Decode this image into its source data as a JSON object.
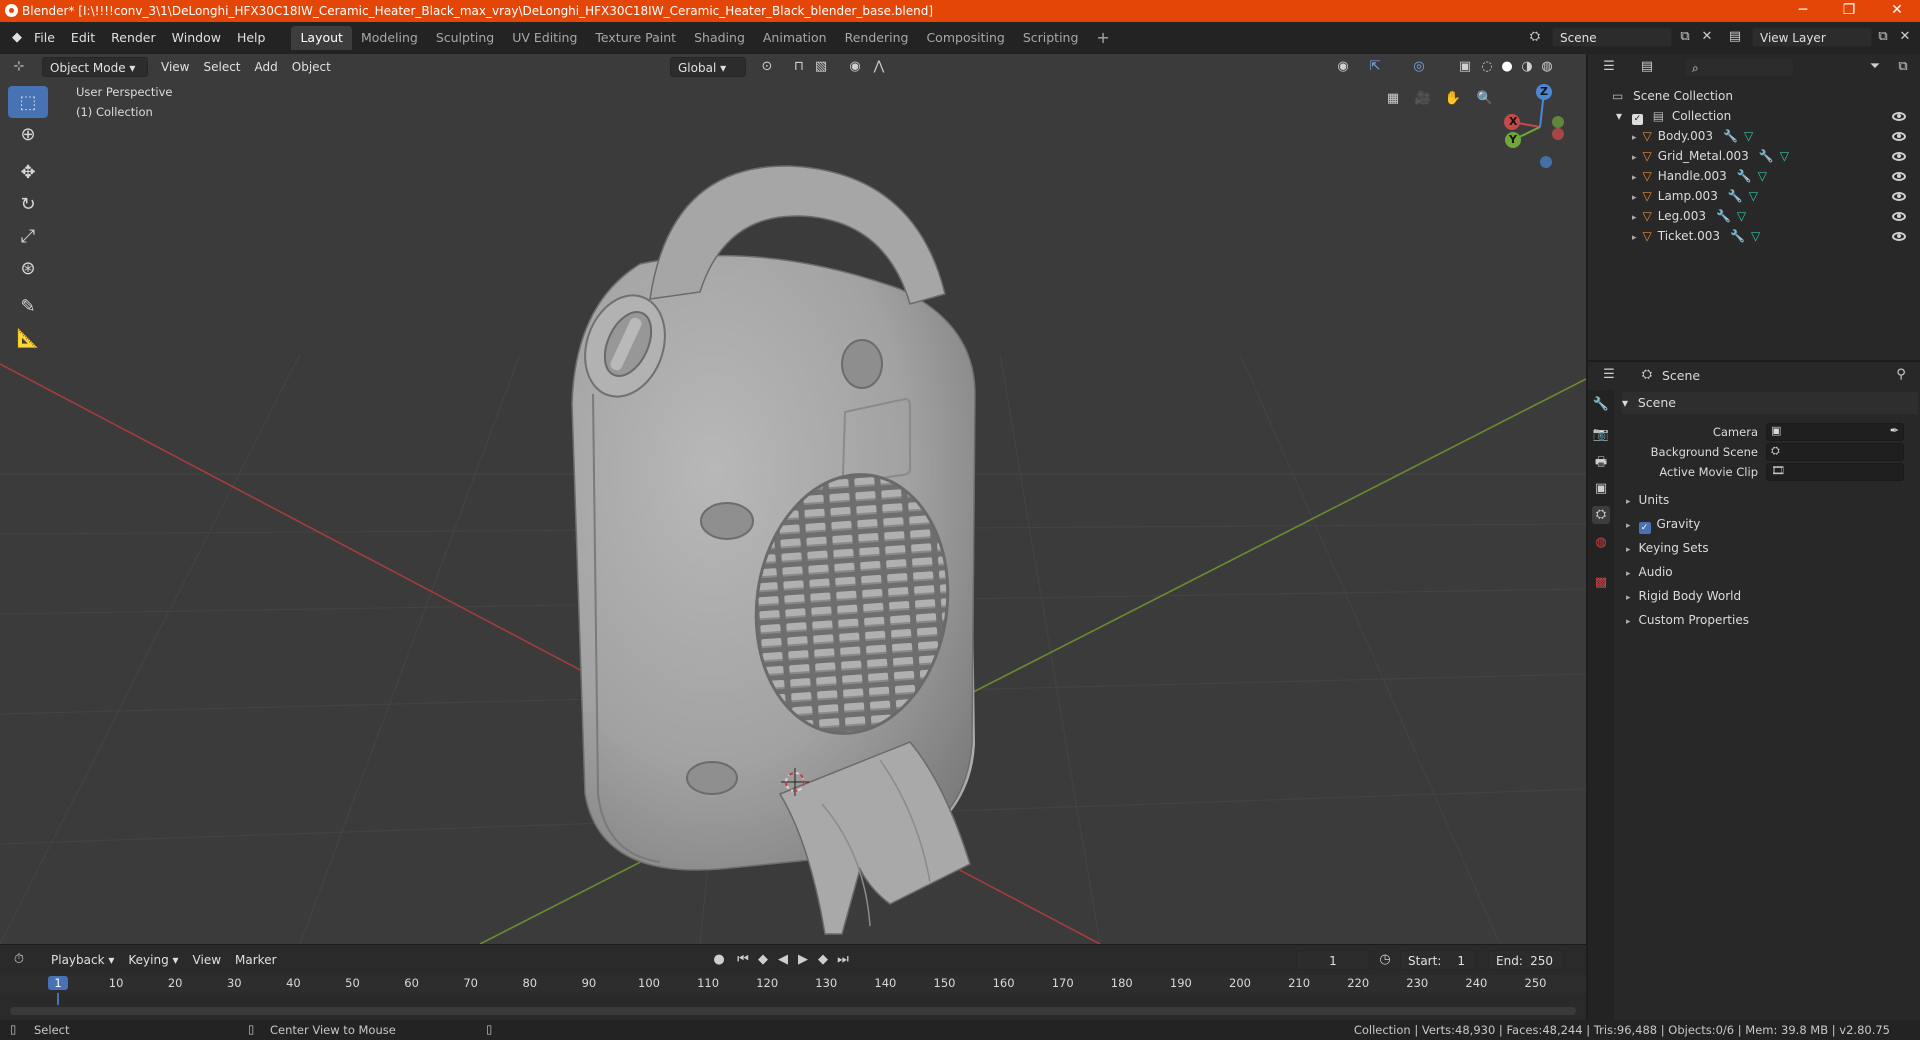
{
  "window": {
    "title": "Blender* [I:\\!!!!conv_3\\1\\DeLonghi_HFX30C18IW_Ceramic_Heater_Black_max_vray\\DeLonghi_HFX30C18IW_Ceramic_Heater_Black_blender_base.blend]",
    "minimize": "─",
    "maximize": "❐",
    "close": "✕"
  },
  "menus": [
    "File",
    "Edit",
    "Render",
    "Window",
    "Help"
  ],
  "workspaces": [
    {
      "label": "Layout",
      "active": true
    },
    {
      "label": "Modeling"
    },
    {
      "label": "Sculpting"
    },
    {
      "label": "UV Editing"
    },
    {
      "label": "Texture Paint"
    },
    {
      "label": "Shading"
    },
    {
      "label": "Animation"
    },
    {
      "label": "Rendering"
    },
    {
      "label": "Compositing"
    },
    {
      "label": "Scripting"
    }
  ],
  "add_workspace": "+",
  "scene_field": "Scene",
  "view_layer_field": "View Layer",
  "viewport": {
    "mode": "Object Mode",
    "menus": [
      "View",
      "Select",
      "Add",
      "Object"
    ],
    "orientation": "Global",
    "overlay_text": [
      "User Perspective",
      "(1) Collection"
    ],
    "gizmo": {
      "z": "Z",
      "y": "Y",
      "x": "X"
    }
  },
  "outliner": {
    "root": "Scene Collection",
    "collection": "Collection",
    "items": [
      "Body.003",
      "Grid_Metal.003",
      "Handle.003",
      "Lamp.003",
      "Leg.003",
      "Ticket.003"
    ]
  },
  "properties": {
    "context": "Scene",
    "panel": "Scene",
    "fields": [
      {
        "label": "Camera"
      },
      {
        "label": "Background Scene"
      },
      {
        "label": "Active Movie Clip"
      }
    ],
    "sections": [
      {
        "label": "Units",
        "checkbox": false
      },
      {
        "label": "Gravity",
        "checkbox": true
      },
      {
        "label": "Keying Sets",
        "checkbox": false
      },
      {
        "label": "Audio",
        "checkbox": false
      },
      {
        "label": "Rigid Body World",
        "checkbox": false
      },
      {
        "label": "Custom Properties",
        "checkbox": false
      }
    ]
  },
  "timeline": {
    "menus": [
      "Playback",
      "Keying",
      "View",
      "Marker"
    ],
    "current_frame": "1",
    "start_label": "Start:",
    "start": "1",
    "end_label": "End:",
    "end": "250",
    "ruler": [
      "1",
      "10",
      "20",
      "30",
      "40",
      "50",
      "60",
      "70",
      "80",
      "90",
      "100",
      "110",
      "120",
      "130",
      "140",
      "150",
      "160",
      "170",
      "180",
      "190",
      "200",
      "210",
      "220",
      "230",
      "240",
      "250"
    ]
  },
  "status": {
    "left": "Select",
    "middle": "Center View to Mouse",
    "right": "Collection | Verts:48,930 | Faces:48,244 | Tris:96,488 | Objects:0/6 | Mem: 39.8 MB | v2.80.75"
  },
  "colors": {
    "titlebar": "#e44607",
    "accent": "#4772b3",
    "viewport_bg": "#3b3b3b",
    "x_axis": "#c44a4a",
    "y_axis": "#7ea238"
  }
}
